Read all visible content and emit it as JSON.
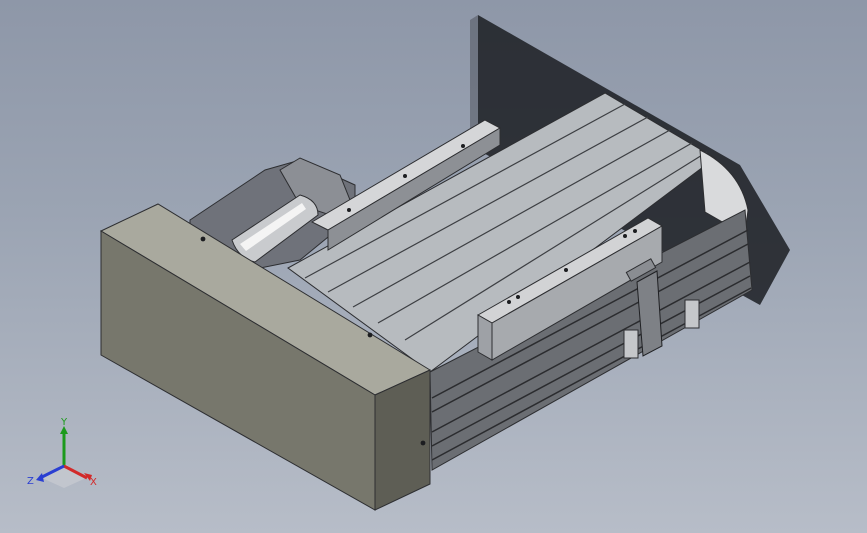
{
  "view": {
    "background_top": "#8e97a8",
    "background_bottom": "#b7bdc8"
  },
  "triad": {
    "x_label": "X",
    "y_label": "Y",
    "z_label": "Z",
    "x_color": "#d22a2a",
    "y_color": "#1c9a1c",
    "z_color": "#2a3fd2"
  }
}
